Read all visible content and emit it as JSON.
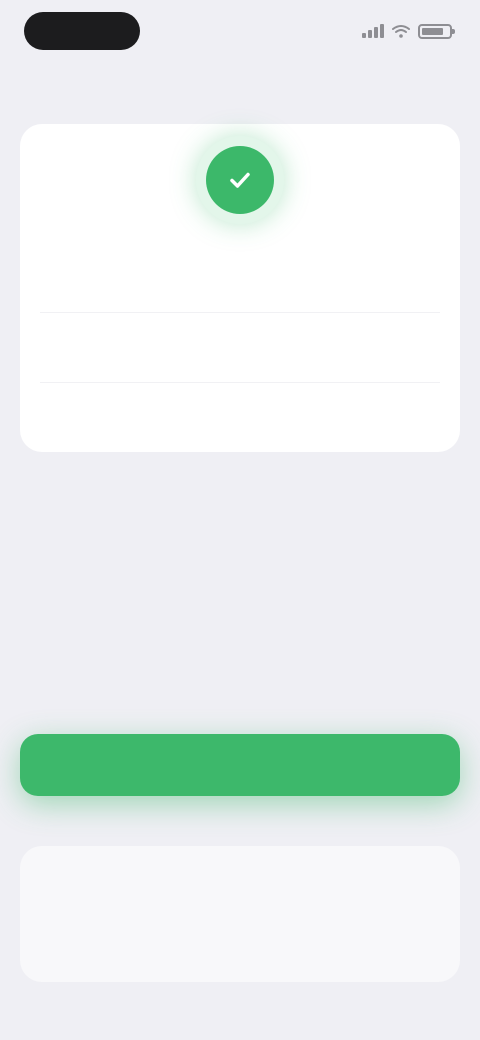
{
  "status_bar": {
    "time": "",
    "signal_icon": "cellular-signal-icon",
    "wifi_icon": "wifi-icon",
    "battery_icon": "battery-icon",
    "battery_level": 0.8
  },
  "card": {
    "badge_icon": "checkmark-icon",
    "badge_color": "#3cb86a",
    "rows": [
      {
        "label": "",
        "value": ""
      },
      {
        "label": "",
        "value": ""
      },
      {
        "label": "",
        "value": ""
      }
    ]
  },
  "primary_button": {
    "label": "",
    "color": "#3db86b"
  },
  "bottom_panel": {
    "label": ""
  }
}
